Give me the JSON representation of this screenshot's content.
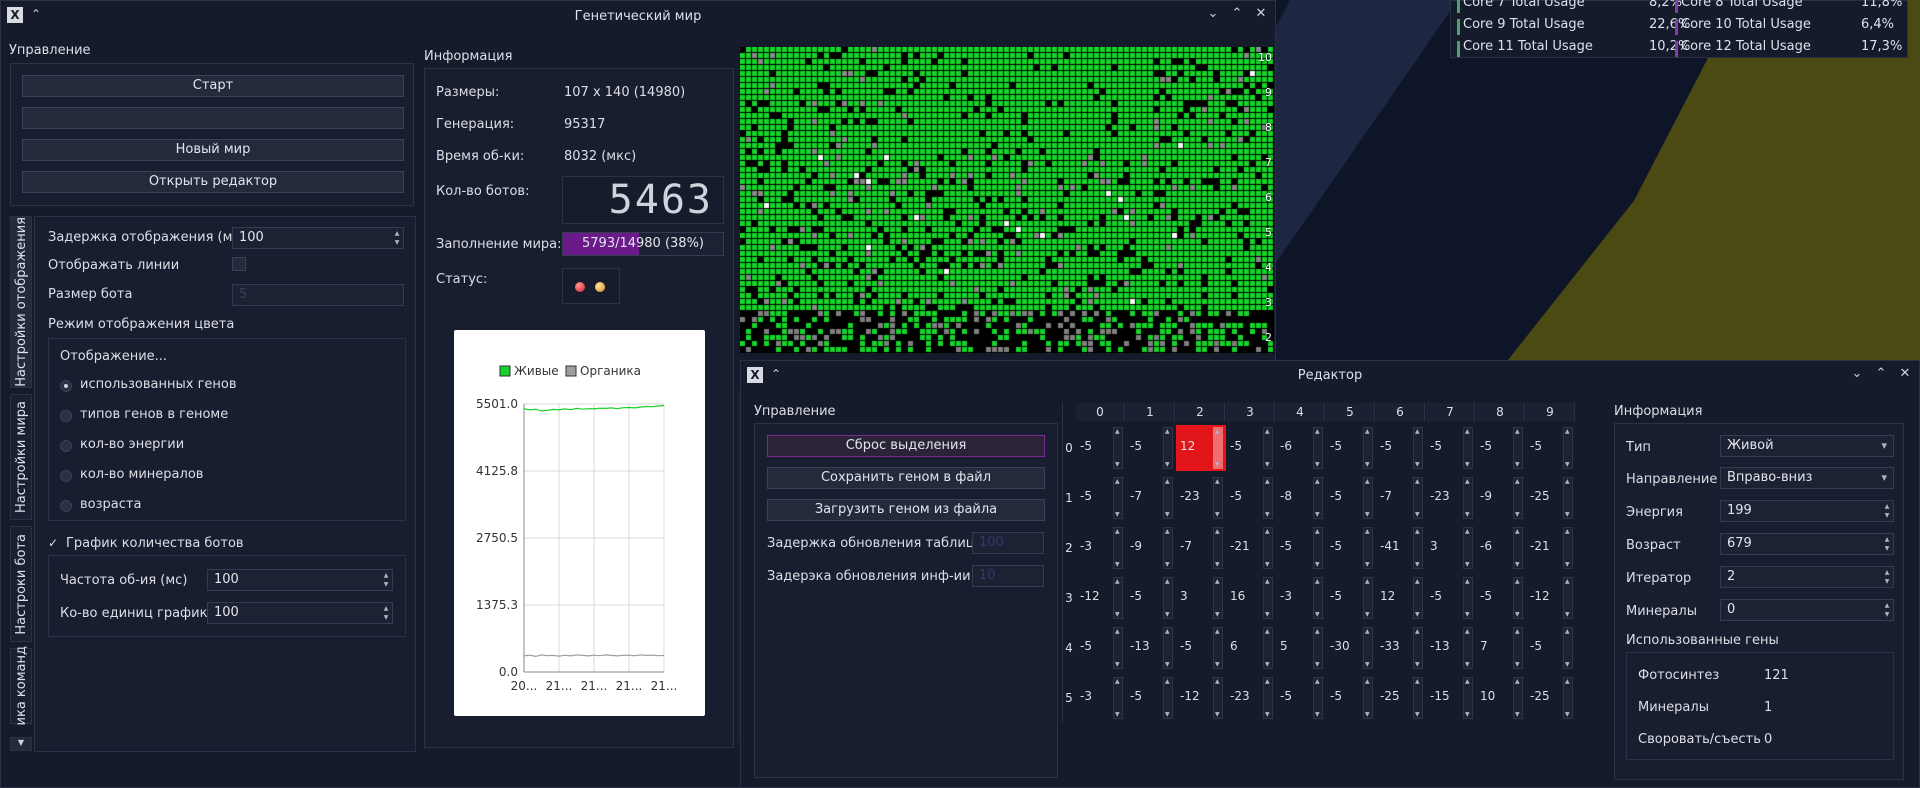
{
  "system_monitor": {
    "rows": [
      {
        "label": "Core 7 Total Usage",
        "value": "8,2%",
        "label2": "Core 8 Total Usage",
        "value2": "11,8%"
      },
      {
        "label": "Core 9 Total Usage",
        "value": "22,6%",
        "label2": "Core 10 Total Usage",
        "value2": "6,4%"
      },
      {
        "label": "Core 11 Total Usage",
        "value": "10,2%",
        "label2": "Core 12 Total Usage",
        "value2": "17,3%"
      }
    ]
  },
  "main_window": {
    "title": "Генетический мир",
    "control": {
      "heading": "Управление",
      "start_label": "Старт",
      "empty_button": "",
      "new_world_label": "Новый мир",
      "open_editor_label": "Открыть редактор"
    },
    "tabs": [
      "Настройки отображения",
      "Настройки мира",
      "Настроки бота",
      "ика команд"
    ],
    "display_settings": {
      "delay_label": "Задержка отображения (мс)",
      "delay_value": "100",
      "show_lines_label": "Отображать линии",
      "bot_size_label": "Размер бота",
      "bot_size_value": "5",
      "color_mode_heading": "Режим отображения цвета",
      "display_group_label": "Отображение...",
      "options": [
        "использованных генов",
        "типов генов в геноме",
        "кол-во энергии",
        "кол-во минералов",
        "возраста"
      ],
      "selected_option": 0,
      "graph_label": "График количества ботов",
      "graph_check": "✓",
      "freq_label": "Частота об-ия (мс)",
      "freq_value": "100",
      "units_label": "Ко-во единиц графика",
      "units_value": "100"
    },
    "info": {
      "heading": "Информация",
      "size_label": "Размеры:",
      "size_value": "107 x 140 (14980)",
      "generation_label": "Генерация:",
      "generation_value": "95317",
      "process_time_label": "Время об-ки:",
      "process_time_value": "8032 (мкс)",
      "bots_count_label": "Кол-во ботов:",
      "bots_count_value": "5463",
      "fill_label": "Заполнение мира:",
      "fill_value": "5793/14980 (38%)",
      "fill_fraction": 0.38,
      "status_label": "Статус:"
    },
    "chart_data": {
      "type": "line",
      "legend": [
        "Живые",
        "Органика"
      ],
      "colors": {
        "alive": "#19d12b",
        "organic": "#9e9e9e"
      },
      "y_ticks": [
        "5501.0",
        "4125.8",
        "2750.5",
        "1375.3",
        "0.0"
      ],
      "x_ticks": [
        "20...",
        "21...",
        "21...",
        "21...",
        "21..."
      ],
      "ylim": [
        0,
        5501
      ],
      "series": [
        {
          "name": "Живые",
          "values": [
            5400,
            5380,
            5395,
            5360,
            5370,
            5390,
            5380,
            5400,
            5385,
            5410,
            5395,
            5405,
            5400,
            5415,
            5410,
            5420,
            5405,
            5425,
            5430,
            5420,
            5440,
            5450,
            5445,
            5460,
            5470
          ]
        },
        {
          "name": "Органика",
          "values": [
            330,
            345,
            320,
            350,
            335,
            340,
            325,
            345,
            330,
            350,
            340,
            330,
            345,
            335,
            350,
            340,
            330,
            345,
            340,
            335,
            350,
            340,
            345,
            335,
            340
          ]
        }
      ]
    },
    "world_row_labels": [
      "10",
      "9",
      "8",
      "7",
      "6",
      "5",
      "4",
      "3",
      "2"
    ]
  },
  "editor_window": {
    "title": "Редактор",
    "control": {
      "heading": "Управление",
      "reset_label": "Сброс выделения",
      "save_label": "Сохранить геном в файл",
      "load_label": "Загрузить геном из файла",
      "table_delay_label": "Задержка обновления таблицы",
      "table_delay_value": "100",
      "info_delay_label": "Задерэка обновления инф-ии",
      "info_delay_value": "10"
    },
    "genome": {
      "columns": [
        "0",
        "1",
        "2",
        "3",
        "4",
        "5",
        "6",
        "7",
        "8",
        "9"
      ],
      "rows": [
        "0",
        "1",
        "2",
        "3",
        "4",
        "5"
      ],
      "values": [
        [
          "-5",
          "-5",
          "12",
          "-5",
          "-6",
          "-5",
          "-5",
          "-5",
          "-5",
          "-5"
        ],
        [
          "-5",
          "-7",
          "-23",
          "-5",
          "-8",
          "-5",
          "-7",
          "-23",
          "-9",
          "-25"
        ],
        [
          "-3",
          "-9",
          "-7",
          "-21",
          "-5",
          "-5",
          "-41",
          "3",
          "-6",
          "-21"
        ],
        [
          "-12",
          "-5",
          "3",
          "16",
          "-3",
          "-5",
          "12",
          "-5",
          "-5",
          "-12"
        ],
        [
          "-5",
          "-13",
          "-5",
          "6",
          "5",
          "-30",
          "-33",
          "-13",
          "7",
          "-5"
        ],
        [
          "-3",
          "-5",
          "-12",
          "-23",
          "-5",
          "-5",
          "-25",
          "-15",
          "10",
          "-25"
        ]
      ],
      "selected": {
        "row": 0,
        "col": 2
      }
    },
    "info": {
      "heading": "Информация",
      "type_label": "Тип",
      "type_value": "Живой",
      "direction_label": "Направление",
      "direction_value": "Вправо-вниз",
      "energy_label": "Энергия",
      "energy_value": "199",
      "age_label": "Возраст",
      "age_value": "679",
      "iterator_label": "Итератор",
      "iterator_value": "2",
      "minerals_label": "Минералы",
      "minerals_value": "0",
      "used_genes_label": "Использованные гены",
      "photosynthesis_label": "Фотосинтез",
      "photosynthesis_value": "121",
      "genes_minerals_label": "Минералы",
      "genes_minerals_value": "1",
      "eat_label": "Своровать/съесть",
      "eat_value": "0"
    }
  }
}
